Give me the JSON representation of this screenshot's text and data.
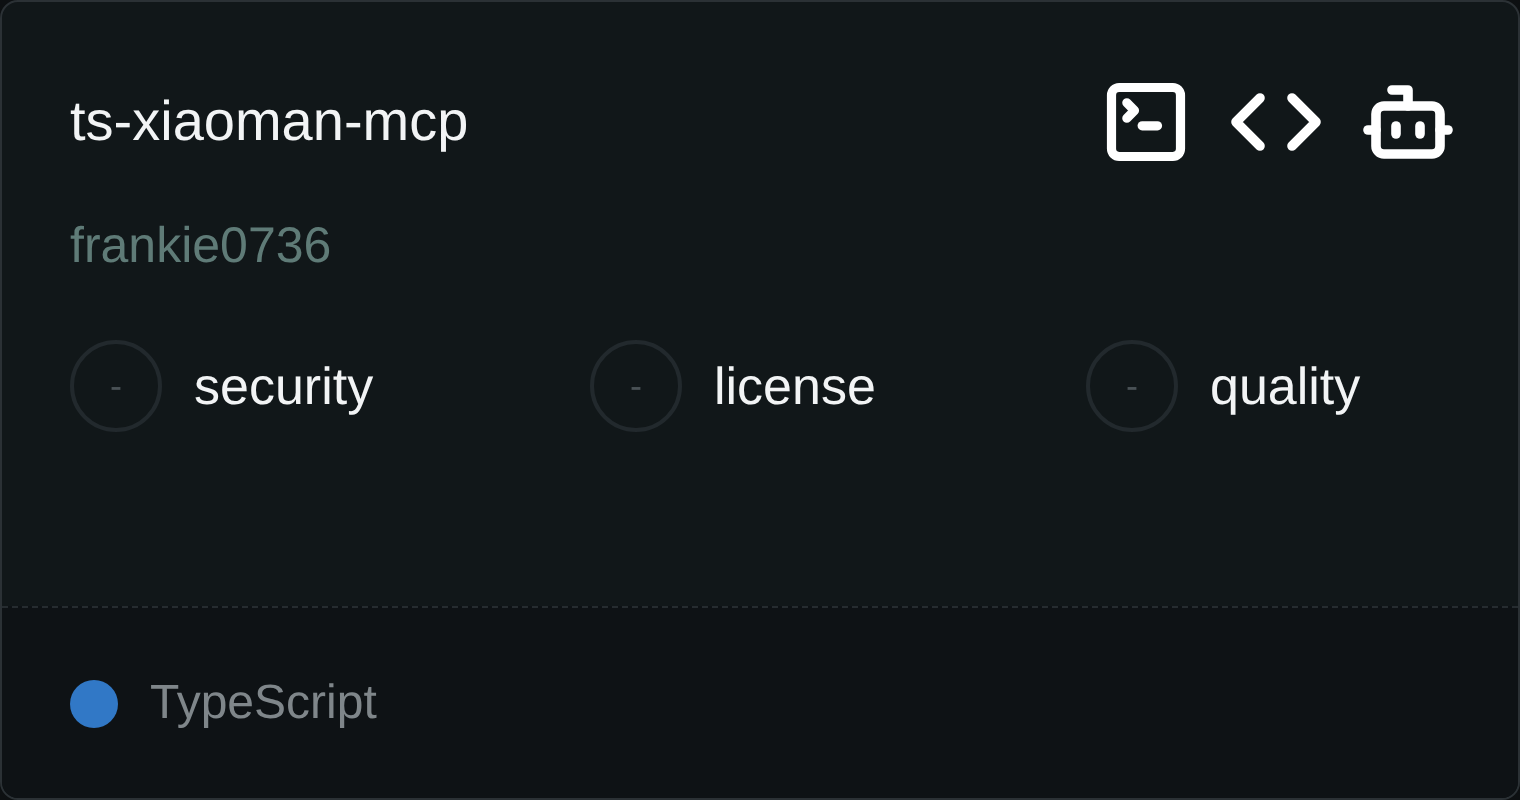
{
  "card": {
    "title": "ts-xiaoman-mcp",
    "author": "frankie0736",
    "metrics": [
      {
        "score": "-",
        "label": "security"
      },
      {
        "score": "-",
        "label": "license"
      },
      {
        "score": "-",
        "label": "quality"
      }
    ],
    "language": {
      "name": "TypeScript",
      "color": "#3178c6"
    }
  }
}
